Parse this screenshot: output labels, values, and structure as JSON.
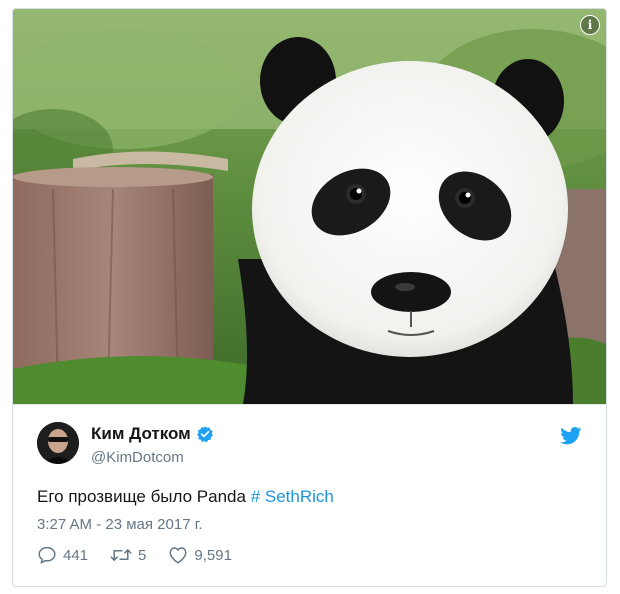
{
  "media": {
    "info_glyph": "i",
    "image": "panda-photo"
  },
  "author": {
    "name": "Ким Дотком",
    "handle": "@KimDotcom",
    "verified_icon": "verified-badge-icon",
    "avatar": "avatar-photo"
  },
  "platform_icon": "twitter-bird-icon",
  "tweet": {
    "text": "Его прозвище было Panda",
    "hashtag": "# SethRich"
  },
  "timestamp": "3:27 AM - 23 мая 2017 г.",
  "actions": {
    "replies": "441",
    "retweets": "5",
    "likes": "9,591"
  },
  "colors": {
    "accent": "#1da1f2",
    "link": "#1b95e0",
    "secondary_text": "#657786"
  }
}
